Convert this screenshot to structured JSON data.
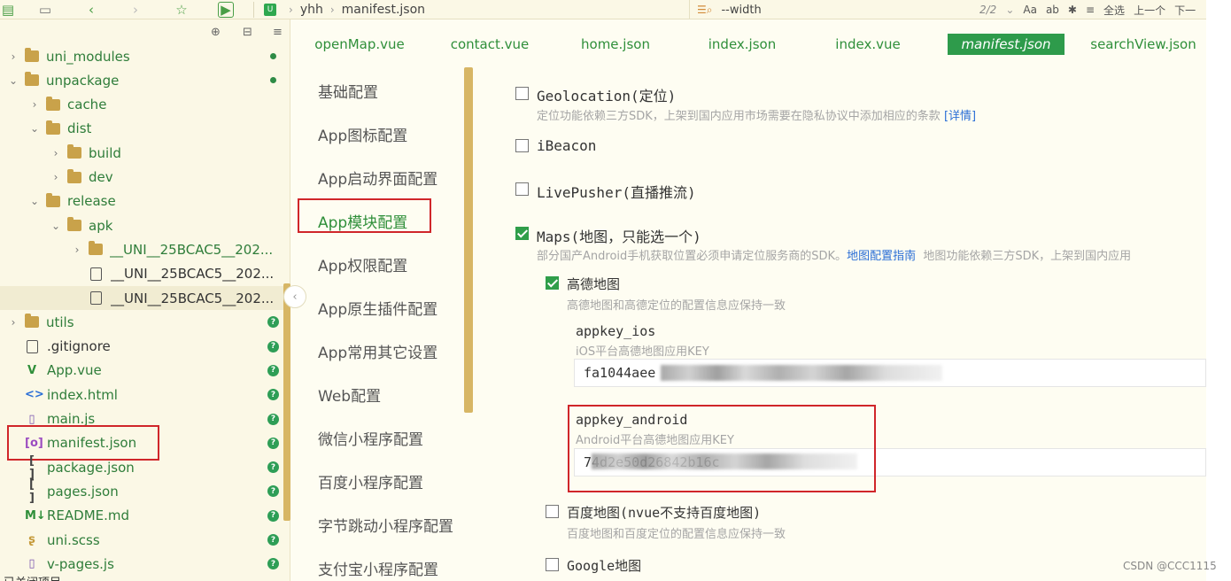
{
  "toolbar": {
    "breadcrumb": [
      "yhh",
      "manifest.json"
    ],
    "badge_letter": "U",
    "search_value": "--width",
    "find_count": "2/2",
    "find_options": [
      "Aa",
      "ab",
      "全选",
      "上一个",
      "下一"
    ]
  },
  "explorer": {
    "rows": [
      {
        "name": "uni_modules",
        "kind": "folder",
        "expand": "closed",
        "status": "dot"
      },
      {
        "name": "unpackage",
        "kind": "folder",
        "expand": "open",
        "status": "dot"
      },
      {
        "name": "cache",
        "kind": "folder",
        "expand": "closed"
      },
      {
        "name": "dist",
        "kind": "folder",
        "expand": "open"
      },
      {
        "name": "build",
        "kind": "folder",
        "expand": "closed"
      },
      {
        "name": "dev",
        "kind": "folder",
        "expand": "closed"
      },
      {
        "name": "release",
        "kind": "folder",
        "expand": "open"
      },
      {
        "name": "apk",
        "kind": "folder",
        "expand": "open"
      },
      {
        "name": "__UNI__25BCAC5__202...",
        "kind": "folder",
        "expand": "closed"
      },
      {
        "name": "__UNI__25BCAC5__202...",
        "kind": "file"
      },
      {
        "name": "__UNI__25BCAC5__202...",
        "kind": "file",
        "selected": true
      },
      {
        "name": "utils",
        "kind": "folder",
        "expand": "closed",
        "status": "q"
      },
      {
        "name": ".gitignore",
        "kind": "file",
        "status": "q"
      },
      {
        "name": "App.vue",
        "kind": "vue",
        "status": "q"
      },
      {
        "name": "index.html",
        "kind": "html",
        "status": "q"
      },
      {
        "name": "main.js",
        "kind": "js",
        "status": "q"
      },
      {
        "name": "manifest.json",
        "kind": "json",
        "status": "q",
        "highlight": true
      },
      {
        "name": "package.json",
        "kind": "brackets",
        "status": "q"
      },
      {
        "name": "pages.json",
        "kind": "brackets",
        "status": "q"
      },
      {
        "name": "README.md",
        "kind": "md",
        "status": "q"
      },
      {
        "name": "uni.scss",
        "kind": "scss",
        "status": "q"
      },
      {
        "name": "v-pages.js",
        "kind": "js",
        "status": "q"
      }
    ],
    "footer": "已关闭项目"
  },
  "tabs": [
    "openMap.vue",
    "contact.vue",
    "home.json",
    "index.json",
    "index.vue",
    "manifest.json",
    "searchView.json"
  ],
  "active_tab": 5,
  "nav": {
    "items": [
      "基础配置",
      "App图标配置",
      "App启动界面配置",
      "App模块配置",
      "App权限配置",
      "App原生插件配置",
      "App常用其它设置",
      "Web配置",
      "微信小程序配置",
      "百度小程序配置",
      "字节跳动小程序配置",
      "支付宝小程序配置"
    ],
    "active": 3
  },
  "modules": {
    "geolocation": {
      "label": "Geolocation(定位)",
      "checked": false,
      "desc": "定位功能依赖三方SDK，上架到国内应用市场需要在隐私协议中添加相应的条款",
      "link": "[详情]"
    },
    "ibeacon": {
      "label": "iBeacon",
      "checked": false
    },
    "livepusher": {
      "label": "LivePusher(直播推流)",
      "checked": false
    },
    "maps": {
      "label": "Maps(地图，只能选一个)",
      "checked": true,
      "desc_a": "部分国产Android手机获取位置必须申请定位服务商的SDK。",
      "link": "地图配置指南",
      "desc_b": "地图功能依赖三方SDK，上架到国内应用",
      "amap": {
        "label": "高德地图",
        "checked": true,
        "desc": "高德地图和高德定位的配置信息应保持一致",
        "ios": {
          "label": "appkey_ios",
          "desc": "iOS平台高德地图应用KEY",
          "value": "fa1044aee"
        },
        "android": {
          "label": "appkey_android",
          "desc": "Android平台高德地图应用KEY",
          "value": "74d2e50d26842b16c"
        }
      },
      "baidu": {
        "label": "百度地图(nvue不支持百度地图)",
        "checked": false,
        "desc": "百度地图和百度定位的配置信息应保持一致"
      },
      "google": {
        "label": "Google地图",
        "checked": false
      }
    }
  },
  "watermark": "CSDN @CCC1115"
}
